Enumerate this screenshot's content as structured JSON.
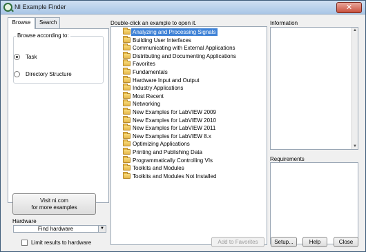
{
  "window": {
    "title": "NI Example Finder",
    "close_glyph": "✕"
  },
  "tabs": [
    {
      "label": "Browse",
      "active": true
    },
    {
      "label": "Search",
      "active": false
    }
  ],
  "browse": {
    "group_title": "Browse according to:",
    "options": [
      {
        "label": "Task",
        "checked": true
      },
      {
        "label": "Directory Structure",
        "checked": false
      }
    ],
    "visit_button_line1": "Visit ni.com",
    "visit_button_line2": "for more examples",
    "hardware_label": "Hardware",
    "hardware_value": "Find hardware",
    "limit_label": "Limit results to hardware"
  },
  "list": {
    "caption": "Double-click an example to open it.",
    "items": [
      "Analyzing and Processing Signals",
      "Building User Interfaces",
      "Communicating with External Applications",
      "Distributing and Documenting Applications",
      "Favorites",
      "Fundamentals",
      "Hardware Input and Output",
      "Industry Applications",
      "Most Recent",
      "Networking",
      "New Examples for LabVIEW 2009",
      "New Examples for LabVIEW 2010",
      "New Examples for LabVIEW 2011",
      "New Examples for LabVIEW 8.x",
      "Optimizing Applications",
      "Printing and Publishing Data",
      "Programmatically Controlling VIs",
      "Toolkits and Modules",
      "Toolkits and Modules Not Installed"
    ],
    "selected_index": 0
  },
  "info": {
    "label": "Information"
  },
  "requirements": {
    "label": "Requirements"
  },
  "buttons": {
    "add_favorites": "Add to Favorites",
    "setup": "Setup...",
    "help": "Help",
    "close": "Close"
  }
}
